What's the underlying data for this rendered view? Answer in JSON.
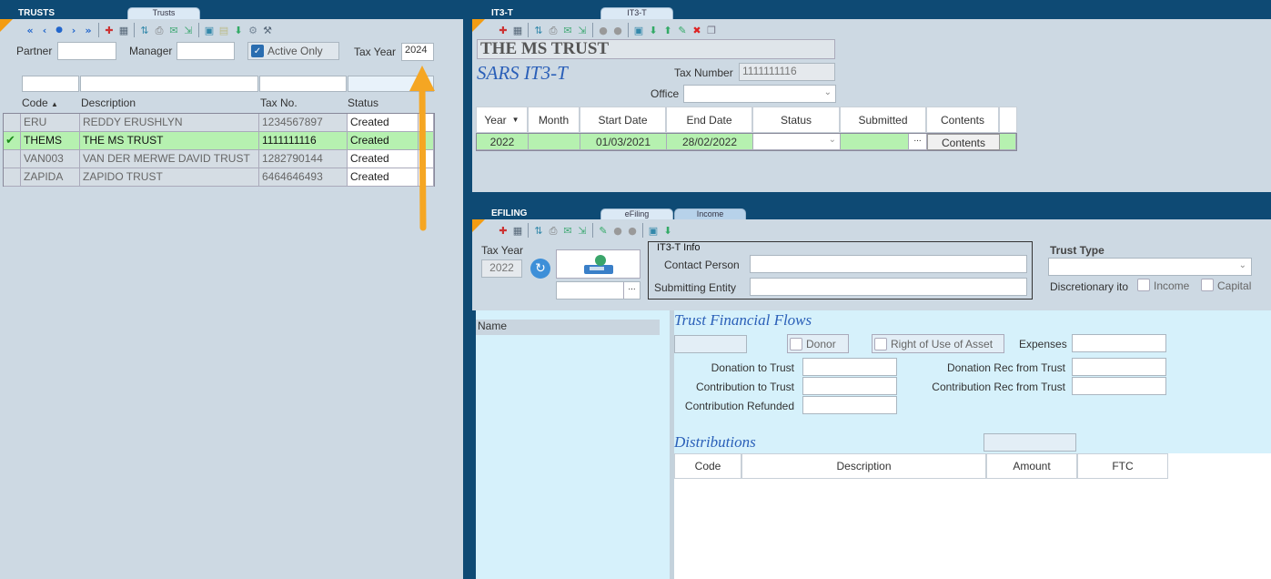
{
  "trusts": {
    "title": "TRUSTS",
    "tab": "Trusts",
    "filters": {
      "partner_label": "Partner",
      "manager_label": "Manager",
      "active_only_label": "Active Only",
      "tax_year_label": "Tax Year",
      "tax_year_value": "2024"
    },
    "columns": [
      "Code",
      "Description",
      "Tax No.",
      "Status"
    ],
    "rows": [
      {
        "code": "ERU",
        "description": "REDDY ERUSHLYN",
        "tax_no": "1234567897",
        "status": "Created"
      },
      {
        "code": "THEMS",
        "description": "THE MS TRUST",
        "tax_no": "1111111116",
        "status": "Created"
      },
      {
        "code": "VAN003",
        "description": "VAN DER MERWE DAVID TRUST",
        "tax_no": "1282790144",
        "status": "Created"
      },
      {
        "code": "ZAPIDA",
        "description": "ZAPIDO TRUST",
        "tax_no": "6464646493",
        "status": "Created"
      }
    ]
  },
  "it3t": {
    "title": "IT3-T",
    "tab": "IT3-T",
    "trust_name": "THE MS TRUST",
    "heading": "SARS IT3-T",
    "tax_number_label": "Tax Number",
    "tax_number_value": "1111111116",
    "office_label": "Office",
    "columns": [
      "Year",
      "Month",
      "Start Date",
      "End Date",
      "Status",
      "Submitted",
      "Contents"
    ],
    "row": {
      "year": "2022",
      "month": "",
      "start_date": "01/03/2021",
      "end_date": "28/02/2022",
      "status": "",
      "submitted": "",
      "contents_button": "Contents",
      "ellipsis": "..."
    }
  },
  "efiling": {
    "title": "EFILING",
    "tabs": [
      "eFiling",
      "Income"
    ],
    "tax_year_label": "Tax Year",
    "tax_year_value": "2022",
    "ellipsis": "...",
    "info_title": "IT3-T Info",
    "contact_person_label": "Contact Person",
    "submitting_entity_label": "Submitting Entity",
    "trust_type_label": "Trust Type",
    "discretionary_label": "Discretionary ito",
    "income_label": "Income",
    "capital_label": "Capital",
    "name_label": "Name",
    "flows_title": "Trust Financial Flows",
    "donor_label": "Donor",
    "right_of_use_label": "Right of Use of Asset",
    "expenses_label": "Expenses",
    "donation_to_trust_label": "Donation to Trust",
    "contribution_to_trust_label": "Contribution to Trust",
    "contribution_refunded_label": "Contribution Refunded",
    "donation_rec_label": "Donation Rec from Trust",
    "contribution_rec_label": "Contribution Rec from Trust",
    "distributions_title": "Distributions",
    "dist_columns": [
      "Code",
      "Description",
      "Amount",
      "FTC"
    ]
  },
  "colors": {
    "accent_arrow": "#f5a623",
    "selected_row": "#b6f1b0",
    "background": "#0e4a74"
  }
}
